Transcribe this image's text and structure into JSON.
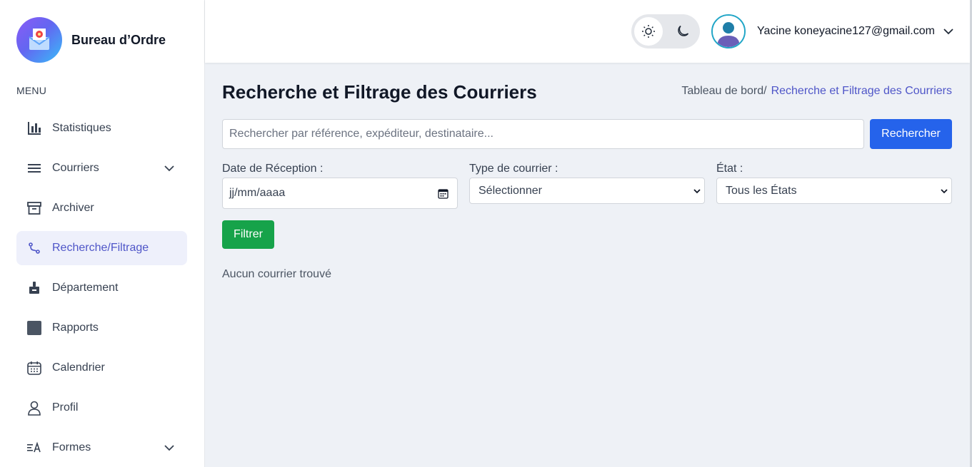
{
  "brand": {
    "title": "Bureau d’Ordre"
  },
  "sidebar": {
    "menu_label": "MENU",
    "items": [
      {
        "label": "Statistiques",
        "icon": "bar-chart-icon"
      },
      {
        "label": "Courriers",
        "icon": "list-icon",
        "has_submenu": true
      },
      {
        "label": "Archiver",
        "icon": "archive-icon"
      },
      {
        "label": "Recherche/Filtrage",
        "icon": "route-icon",
        "active": true
      },
      {
        "label": "Département",
        "icon": "stamp-icon"
      },
      {
        "label": "Rapports",
        "icon": "report-icon"
      },
      {
        "label": "Calendrier",
        "icon": "calendar-icon"
      },
      {
        "label": "Profil",
        "icon": "user-icon"
      },
      {
        "label": "Formes",
        "icon": "text-format-icon",
        "has_submenu": true
      }
    ]
  },
  "header": {
    "user_name": "Yacine koneyacine127@gmail.com"
  },
  "main": {
    "title": "Recherche et Filtrage des Courriers",
    "breadcrumb": {
      "root": "Tableau de bord/",
      "current": "Recherche et Filtrage des Courriers"
    },
    "search": {
      "placeholder": "Rechercher par référence, expéditeur, destinataire...",
      "button": "Rechercher"
    },
    "filters": {
      "date_label": "Date de Réception :",
      "date_placeholder": "jj/mm/aaaa",
      "type_label": "Type de courrier :",
      "type_value": "Sélectionner",
      "state_label": "État :",
      "state_value": "Tous les États",
      "button": "Filtrer"
    },
    "empty_message": "Aucun courrier trouvé"
  },
  "colors": {
    "accent": "#4f56c8",
    "primary_button": "#2563eb",
    "success_button": "#16a34a",
    "active_bg": "#eef0fb"
  }
}
